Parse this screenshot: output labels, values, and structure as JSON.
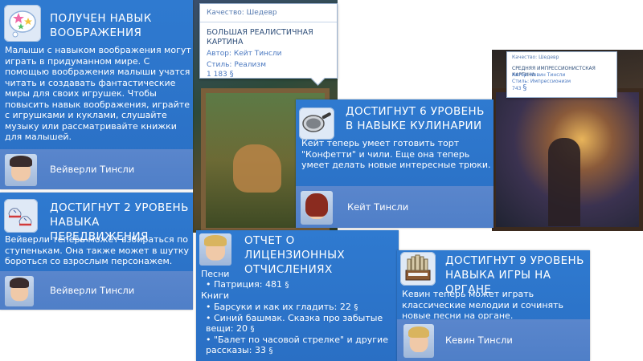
{
  "tooltips": [
    {
      "quality": "Качество: Шедевр",
      "title": "Большая реалистичная картина",
      "author": "Автор: Кейт Тинсли",
      "style": "Стиль: Реализм",
      "price": "1 183"
    },
    {
      "quality": "Качество: Шедевр",
      "title": "Средняя импрессионистская картина",
      "author": "Автор: Кевин Тинсли",
      "style": "Стиль: Импрессионизм",
      "price": "743"
    }
  ],
  "notifications": {
    "imagination": {
      "icon": "stars-bubble-icon",
      "heading": "Получен навык воображения",
      "body": "Малыши с навыком воображения могут играть в придуманном мире. С помощью воображения малыши учатся читать и создавать фантастические миры для своих игрушек. Чтобы повысить навык воображения, играйте с игрушками и куклами, слушайте музыку или рассматривайте книжки для малышей.",
      "sim_name": "Вейверли Тинсли"
    },
    "movement": {
      "icon": "sneakers-icon",
      "heading": "Достигнут 2 уровень навыка передвижения",
      "body": "Вейверли теперь может взбираться по ступенькам. Она также может в шутку бороться со взрослым персонажем.",
      "sim_name": "Вейверли Тинсли"
    },
    "cooking": {
      "icon": "frying-pan-icon",
      "heading": "Достигнут 6 уровень в навыке кулинарии",
      "body": "Кейт теперь умеет готовить торт \"Конфетти\" и чили. Еще она теперь умеет делать новые интересные трюки.",
      "sim_name": "Кейт Тинсли"
    },
    "royalties": {
      "heading": "Отчет о лицензионных отчислениях",
      "sections": [
        {
          "label": "Песни",
          "items": [
            {
              "text": "• Патриция: 481"
            }
          ]
        },
        {
          "label": "Книги",
          "items": [
            {
              "text": "• Барсуки и как их гладить: 22"
            },
            {
              "text": "• Синий башмак. Сказка про забытые вещи: 20"
            },
            {
              "text": "• \"Балет по часовой стрелке\" и другие рассказы: 33"
            }
          ]
        }
      ]
    },
    "organ": {
      "icon": "pipe-organ-icon",
      "heading": "Достигнут 9 уровень навыка игры на органе",
      "body": "Кевин теперь может играть классические мелодии и сочинять новые песни на органе.",
      "sim_name": "Кевин Тинсли"
    }
  },
  "currency_symbol": "§",
  "colors": {
    "notification_bg": "#2f7ad0",
    "footer_bg": "#5a86cc",
    "tooltip_text": "#4a78c0"
  }
}
